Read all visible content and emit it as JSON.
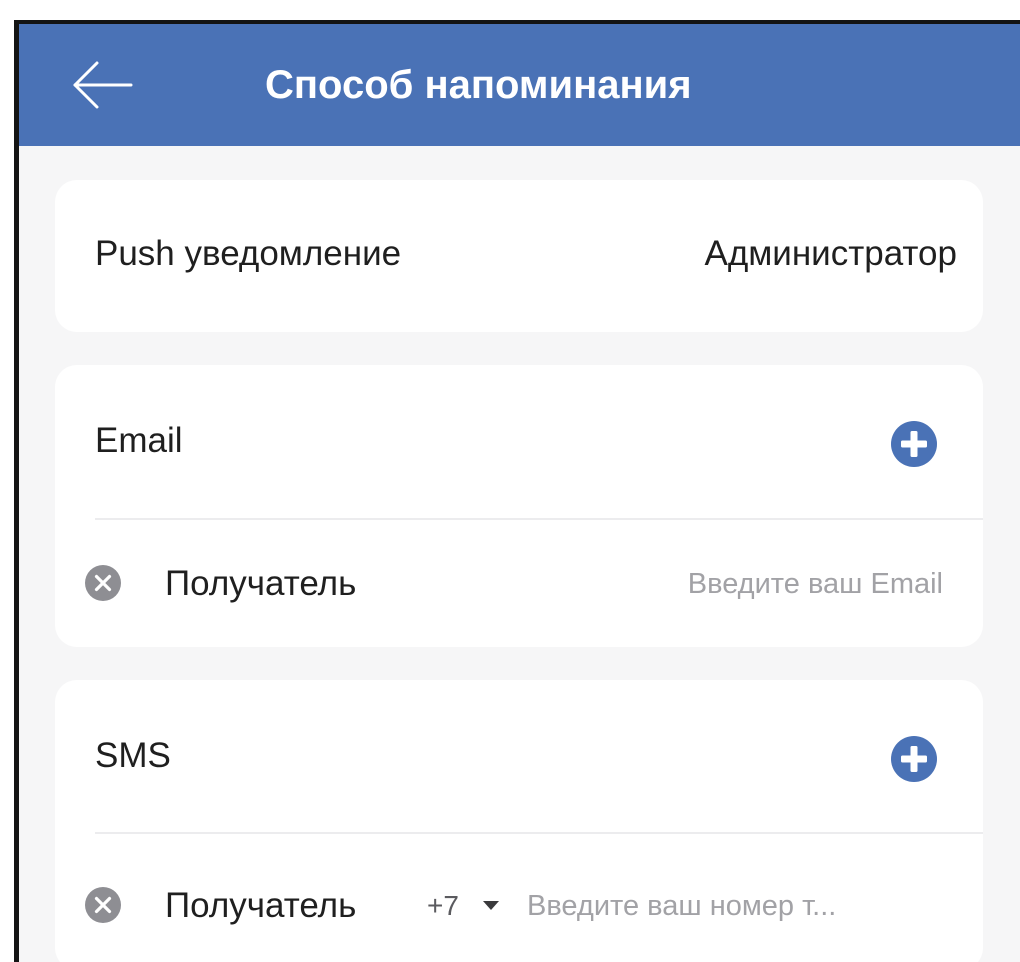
{
  "header": {
    "title": "Способ напоминания",
    "back_icon": "arrow-left-icon",
    "background_color": "#4a72b6"
  },
  "push": {
    "label": "Push уведомление",
    "value": "Администратор"
  },
  "email": {
    "label": "Email",
    "add_icon": "plus-circle-icon",
    "recipient": {
      "remove_icon": "close-circle-icon",
      "label": "Получатель",
      "placeholder": "Введите ваш Email",
      "value": ""
    }
  },
  "sms": {
    "label": "SMS",
    "add_icon": "plus-circle-icon",
    "recipient": {
      "remove_icon": "close-circle-icon",
      "label": "Получатель",
      "country_code": "+7",
      "placeholder": "Введите ваш номер т...",
      "value": ""
    }
  },
  "colors": {
    "accent": "#4a72b6",
    "background": "#f6f6f7",
    "card": "#ffffff",
    "placeholder": "#a2a2a6",
    "remove_icon": "#8e8e93"
  }
}
